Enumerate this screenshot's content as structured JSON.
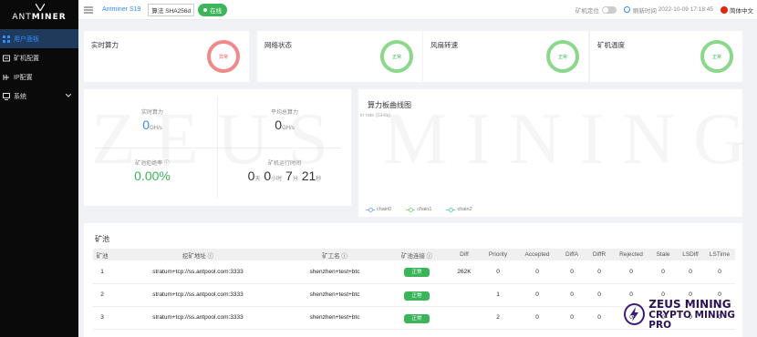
{
  "logo": {
    "text_a": "ANT",
    "text_b": "MINER"
  },
  "sidebar": {
    "items": [
      {
        "label": "用户面板",
        "active": true
      },
      {
        "label": "矿机配置"
      },
      {
        "label": "IP配置"
      },
      {
        "label": "系统",
        "has_children": true
      }
    ]
  },
  "header": {
    "model": "Antminer S19",
    "algo": "算法 SHA256d",
    "status": "在线",
    "locate_label": "矿机定位",
    "refresh_label": "刷新时间",
    "refresh_time": "2022-10-09 17:18:45",
    "language": "简体中文"
  },
  "status_cards": [
    {
      "title": "实时算力",
      "status": "异常",
      "color": "red"
    },
    {
      "title": "网络状态",
      "status": "正常",
      "color": "green"
    },
    {
      "title": "风扇转速",
      "status": "正常",
      "color": "green"
    },
    {
      "title": "矿机温度",
      "status": "正常",
      "color": "green"
    }
  ],
  "stats": {
    "realtime_label": "实时算力",
    "realtime_value": "0",
    "realtime_unit": "GH/s",
    "avg_label": "平均总算力",
    "avg_value": "0",
    "avg_unit": "GH/s",
    "reject_label": "矿池拒绝率",
    "reject_value": "0.00%",
    "uptime_label": "矿机运行时间",
    "uptime_d": "0",
    "uptime_d_unit": "天",
    "uptime_h": "0",
    "uptime_h_unit": "小时",
    "uptime_m": "7",
    "uptime_m_unit": "分",
    "uptime_s": "21",
    "uptime_s_unit": "秒"
  },
  "curve": {
    "title": "算力板曲线图",
    "y_label": "in rate (GH/s)",
    "legend": [
      {
        "name": "chain0",
        "color": "#7fb6f5"
      },
      {
        "name": "chain1",
        "color": "#8bd88a"
      },
      {
        "name": "chain2",
        "color": "#6fd6c2"
      }
    ]
  },
  "pool": {
    "title": "矿池",
    "headers": [
      "矿池",
      "挖矿地址",
      "矿工名",
      "矿池连接",
      "Diff",
      "Priority",
      "Accepted",
      "DiffA",
      "DiffR",
      "Rejected",
      "Stale",
      "LSDiff",
      "LSTime"
    ],
    "rows": [
      [
        "1",
        "stratum+tcp://ss.antpool.com:3333",
        "shenzhen+test+btc",
        "正常",
        "262K",
        "0",
        "0",
        "0",
        "0",
        "0",
        "0",
        "0",
        "0"
      ],
      [
        "2",
        "stratum+tcp://ss.antpool.com:3333",
        "shenzhen+test+btc",
        "正常",
        "",
        "1",
        "0",
        "0",
        "0",
        "0",
        "0",
        "0",
        "0"
      ],
      [
        "3",
        "stratum+tcp://ss.antpool.com:3333",
        "shenzhen+test+btc",
        "正常",
        "",
        "2",
        "0",
        "0",
        "0",
        "0",
        "0",
        "0",
        "0"
      ]
    ]
  },
  "watermark": "ZEUS MINING",
  "brand": {
    "line1": "ZEUS MINING",
    "line2": "CRYPTO MINING PRO"
  },
  "colors": {
    "accent": "#2f8dff",
    "ok": "#3cb55a",
    "warn": "#f08a8a",
    "sidebar": "#0a0a0a"
  }
}
